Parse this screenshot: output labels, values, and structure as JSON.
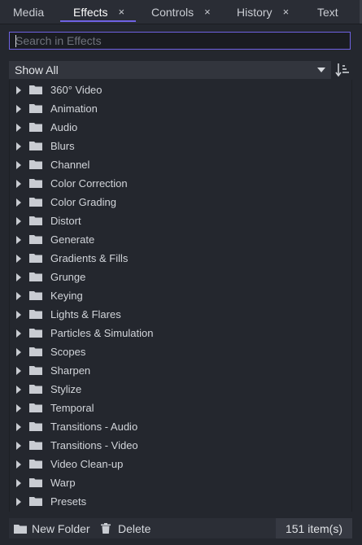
{
  "tabs": [
    {
      "label": "Media",
      "closable": false,
      "active": false
    },
    {
      "label": "Effects",
      "closable": true,
      "active": true
    },
    {
      "label": "Controls",
      "closable": true,
      "active": false
    },
    {
      "label": "History",
      "closable": true,
      "active": false
    },
    {
      "label": "Text",
      "closable": false,
      "active": false
    }
  ],
  "close_glyph": "×",
  "search": {
    "placeholder": "Search in Effects",
    "value": ""
  },
  "filter": {
    "selected": "Show All"
  },
  "folders": [
    "360° Video",
    "Animation",
    "Audio",
    "Blurs",
    "Channel",
    "Color Correction",
    "Color Grading",
    "Distort",
    "Generate",
    "Gradients & Fills",
    "Grunge",
    "Keying",
    "Lights & Flares",
    "Particles & Simulation",
    "Scopes",
    "Sharpen",
    "Stylize",
    "Temporal",
    "Transitions - Audio",
    "Transitions - Video",
    "Video Clean-up",
    "Warp",
    "Presets"
  ],
  "bottom": {
    "new_folder_label": "New Folder",
    "delete_label": "Delete",
    "item_count": "151 item(s)"
  },
  "icons": {
    "folder": "folder-icon",
    "expand": "chevron-right-icon",
    "sort": "sort-icon",
    "dropdown": "chevron-down-icon",
    "delete": "trash-icon",
    "close": "close-icon"
  },
  "colors": {
    "accent": "#6f62e3",
    "background": "#24272e",
    "panel": "#2a2d35",
    "text": "#d2d5da"
  }
}
